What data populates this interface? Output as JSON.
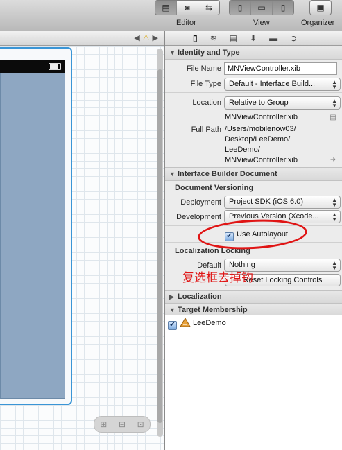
{
  "toolbar": {
    "groups": [
      {
        "label": "Editor"
      },
      {
        "label": "View"
      },
      {
        "label": "Organizer"
      }
    ]
  },
  "canvas": {
    "nav_icons": [
      "left-arrow-icon",
      "warning-icon",
      "right-arrow-icon"
    ]
  },
  "inspector": {
    "identity": {
      "title": "Identity and Type",
      "file_name_label": "File Name",
      "file_name": "MNViewController.xib",
      "file_type_label": "File Type",
      "file_type": "Default - Interface Build...",
      "location_label": "Location",
      "location": "Relative to Group",
      "location_file": "MNViewController.xib",
      "full_path_label": "Full Path",
      "full_path": [
        "/Users/mobilenow03/",
        "Desktop/LeeDemo/",
        "LeeDemo/",
        "MNViewController.xib"
      ]
    },
    "ib_document": {
      "title": "Interface Builder Document",
      "versioning_title": "Document Versioning",
      "deployment_label": "Deployment",
      "deployment": "Project SDK (iOS 6.0)",
      "development_label": "Development",
      "development": "Previous Version (Xcode...",
      "autolayout_label": "Use Autolayout",
      "autolayout_checked": true,
      "locking_title": "Localization Locking",
      "default_label": "Default",
      "default_value": "Nothing",
      "reset_button": "Reset Locking Controls"
    },
    "localization": {
      "title": "Localization"
    },
    "target": {
      "title": "Target Membership",
      "items": [
        {
          "label": "LeeDemo",
          "checked": true
        }
      ]
    }
  },
  "annotation": {
    "text": "复选框去掉钩",
    "color": "#e01515"
  }
}
